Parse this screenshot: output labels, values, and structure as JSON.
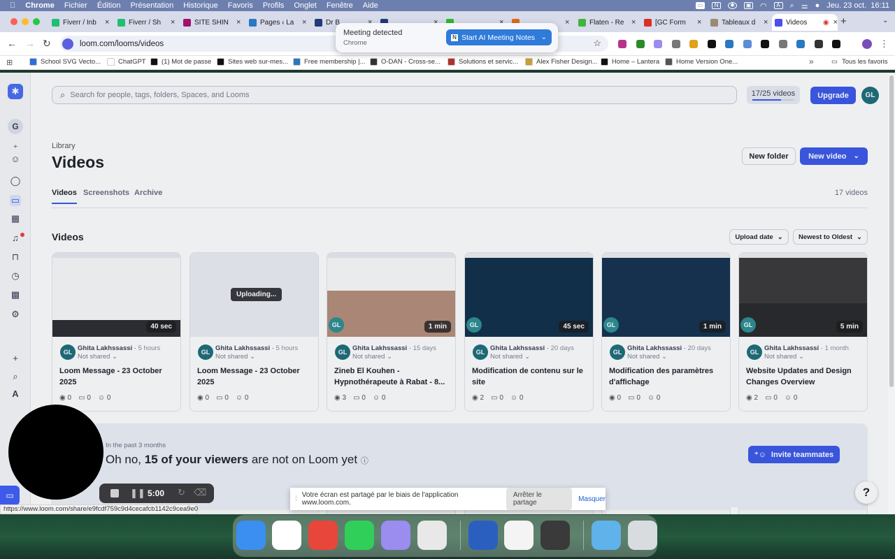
{
  "menubar": {
    "app": "Chrome",
    "items": [
      "Fichier",
      "Édition",
      "Présentation",
      "Historique",
      "Favoris",
      "Profils",
      "Onglet",
      "Fenêtre",
      "Aide"
    ],
    "datetime": "Jeu. 23 oct.  16:11"
  },
  "tabs": [
    {
      "title": "Fiverr / Inb",
      "color": "#1dbf73"
    },
    {
      "title": "Fiverr / Sh",
      "color": "#1dbf73"
    },
    {
      "title": "SITE SHIN",
      "color": "#a0126b"
    },
    {
      "title": "Pages ‹ La",
      "color": "#2a78c2"
    },
    {
      "title": "Dr B",
      "color": "#203a7a"
    },
    {
      "title": "",
      "color": "#203a7a"
    },
    {
      "title": "",
      "color": "#2eb82e"
    },
    {
      "title": "",
      "color": "#e06a1a"
    },
    {
      "title": "Flaten - Re",
      "color": "#3fb53f"
    },
    {
      "title": "[GC Form",
      "color": "#d93025"
    },
    {
      "title": "Tableaux d",
      "color": "#9b8b75"
    },
    {
      "title": "Videos",
      "color": "#4a4df0"
    }
  ],
  "toolbar": {
    "url": "loom.com/looms/videos"
  },
  "bookmarks": [
    {
      "label": "School SVG Vecto...",
      "color": "#2d6fd6"
    },
    {
      "label": "ChatGPT",
      "color": "#ffffff"
    },
    {
      "label": "(1) Mot de passe",
      "color": "#111111"
    },
    {
      "label": "Sites web sur-mes...",
      "color": "#111111"
    },
    {
      "label": "Free membership |...",
      "color": "#2a78c2"
    },
    {
      "label": "O-DAN - Cross-se...",
      "color": "#333333"
    },
    {
      "label": "Solutions et servic...",
      "color": "#b0322a"
    },
    {
      "label": "Alex Fisher Design...",
      "color": "#c6a035"
    },
    {
      "label": "Home – Lantera",
      "color": "#111111"
    },
    {
      "label": "Home Version One...",
      "color": "#555555"
    },
    {
      "label": "Tous les favoris",
      "color": "#555555"
    }
  ],
  "meeting": {
    "title": "Meeting detected",
    "subtitle": "Chrome",
    "button": "Start AI Meeting Notes"
  },
  "header": {
    "search_placeholder": "Search for people, tags, folders, Spaces, and Looms",
    "usage": "17/25 videos",
    "usage_fraction": 0.68,
    "upgrade": "Upgrade",
    "avatar": "GL"
  },
  "rail": {
    "workspace": "G"
  },
  "library": {
    "breadcrumb": "Library",
    "title": "Videos",
    "new_folder": "New folder",
    "new_video": "New video",
    "tabs": [
      "Videos",
      "Screenshots",
      "Archive"
    ],
    "count": "17 videos",
    "section": "Videos",
    "sort_field": "Upload date",
    "sort_order": "Newest to Oldest"
  },
  "videos": [
    {
      "duration": "40 sec",
      "author": "Ghita Lakhssassi",
      "ago": "5 hours",
      "shared": "Not shared",
      "title": "Loom Message - 23 October 2025",
      "views": "0",
      "comments": "0",
      "reactions": "0",
      "uploading": "",
      "initials": ""
    },
    {
      "duration": "",
      "author": "Ghita Lakhssassi",
      "ago": "5 hours",
      "shared": "Not shared",
      "title": "Loom Message - 23 October 2025",
      "views": "0",
      "comments": "0",
      "reactions": "0",
      "uploading": "Uploading...",
      "initials": ""
    },
    {
      "duration": "1 min",
      "author": "Ghita Lakhssassi",
      "ago": "15 days",
      "shared": "Not shared",
      "title": "Zineb El Kouhen - Hypnothérapeute à Rabat - 8...",
      "views": "3",
      "comments": "0",
      "reactions": "0",
      "uploading": "",
      "initials": "GL"
    },
    {
      "duration": "45 sec",
      "author": "Ghita Lakhssassi",
      "ago": "20 days",
      "shared": "Not shared",
      "title": "Modification de contenu sur le site",
      "views": "2",
      "comments": "0",
      "reactions": "0",
      "uploading": "",
      "initials": "GL"
    },
    {
      "duration": "1 min",
      "author": "Ghita Lakhssassi",
      "ago": "20 days",
      "shared": "Not shared",
      "title": "Modification des paramètres d'affichage",
      "views": "0",
      "comments": "0",
      "reactions": "0",
      "uploading": "",
      "initials": "GL"
    },
    {
      "duration": "5 min",
      "author": "Ghita Lakhssassi",
      "ago": "1 month",
      "shared": "Not shared",
      "title": "Website Updates and Design Changes Overview",
      "views": "2",
      "comments": "0",
      "reactions": "0",
      "uploading": "",
      "initials": "GL"
    }
  ],
  "banner": {
    "kicker": "In the past 3 months",
    "pre": "Oh no,",
    "bold": "15 of your viewers",
    "post": "are not on Loom yet",
    "button": "Invite teammates"
  },
  "recorder": {
    "time": "5:00"
  },
  "share": {
    "message": "Votre écran est partagé par le biais de l'application www.loom.com.",
    "stop": "Arrêter le partage",
    "hide": "Masquer"
  },
  "status_url": "https://www.loom.com/share/e9fcdf759c9d4cecafcb1142c9cea9e0",
  "help": "?",
  "avatar_initials": "GL",
  "dock": [
    {
      "name": "finder-icon",
      "color": "#3a8ff0"
    },
    {
      "name": "notion-icon",
      "color": "#ffffff"
    },
    {
      "name": "chrome-icon",
      "color": "#e8463a"
    },
    {
      "name": "whatsapp-icon",
      "color": "#2fcf5a"
    },
    {
      "name": "notes-stack-icon",
      "color": "#9b8cf0"
    },
    {
      "name": "launchpad-icon",
      "color": "#e8e8e8"
    },
    {
      "name": "word-icon",
      "color": "#2b5fbf"
    },
    {
      "name": "textedit-icon",
      "color": "#f4f4f4"
    },
    {
      "name": "calculator-icon",
      "color": "#3a3a3a"
    },
    {
      "name": "folder-icon",
      "color": "#5fb2ea"
    },
    {
      "name": "trash-icon",
      "color": "#d8dcdf"
    }
  ]
}
